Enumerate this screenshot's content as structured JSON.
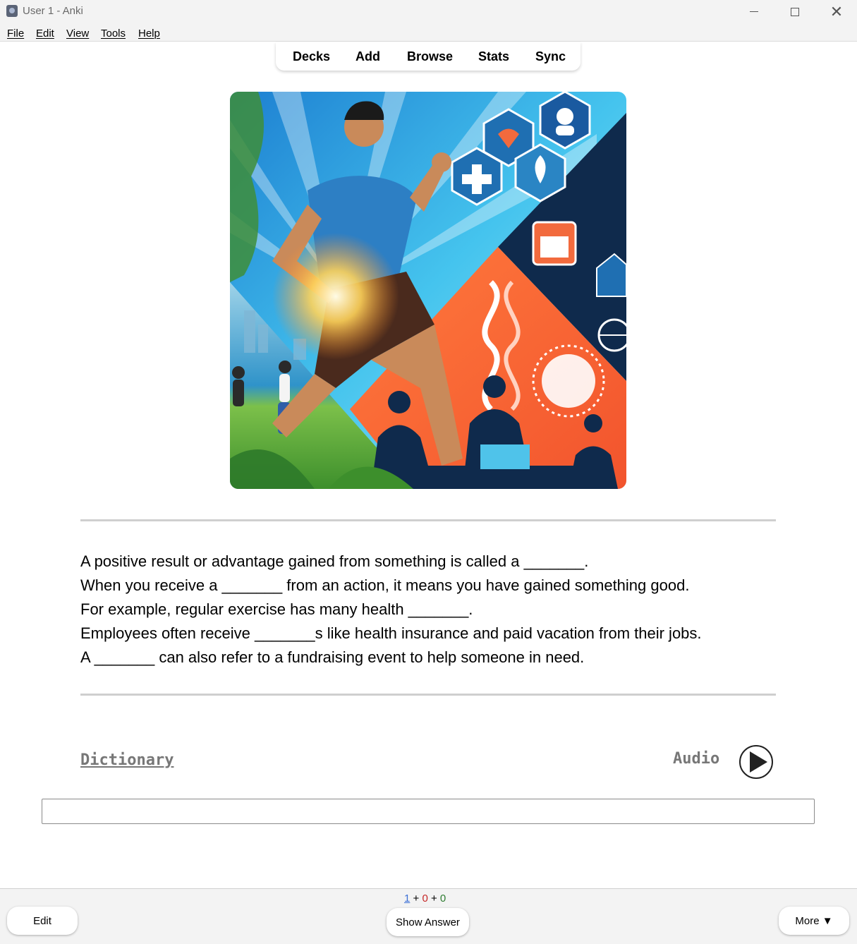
{
  "window": {
    "title": "User 1 - Anki"
  },
  "menu": [
    "File",
    "Edit",
    "View",
    "Tools",
    "Help"
  ],
  "toolbar": {
    "decks": "Decks",
    "add": "Add",
    "browse": "Browse",
    "stats": "Stats",
    "sync": "Sync"
  },
  "card": {
    "lines": [
      "A positive result or advantage gained from something is called a _______.",
      "When you receive a _______ from an action, it means you have gained something good.",
      "For example, regular exercise has many health _______.",
      "Employees often receive _______s like health insurance and paid vacation from their jobs.",
      "A _______ can also refer to a fundraising event to help someone in need."
    ],
    "dictionary_label": "Dictionary",
    "audio_label": "Audio",
    "answer_value": ""
  },
  "counts": {
    "new": "1",
    "sep1": "+",
    "learn": "0",
    "sep2": "+",
    "review": "0"
  },
  "buttons": {
    "edit": "Edit",
    "show_answer": "Show Answer",
    "more": "More ▼"
  },
  "colors": {
    "new": "#3b6fd6",
    "learn": "#c62828",
    "review": "#2e7d32",
    "accent_orange": "#f26a3d",
    "accent_blue": "#1ea0d8"
  },
  "icons": [
    "anki-app-icon",
    "minimize-icon",
    "maximize-icon",
    "close-icon",
    "play-icon",
    "heart-icon",
    "person-icon",
    "medical-cross-icon",
    "leaf-icon",
    "calendar-icon",
    "dna-icon",
    "sun-icon",
    "house-icon",
    "globe-icon"
  ]
}
